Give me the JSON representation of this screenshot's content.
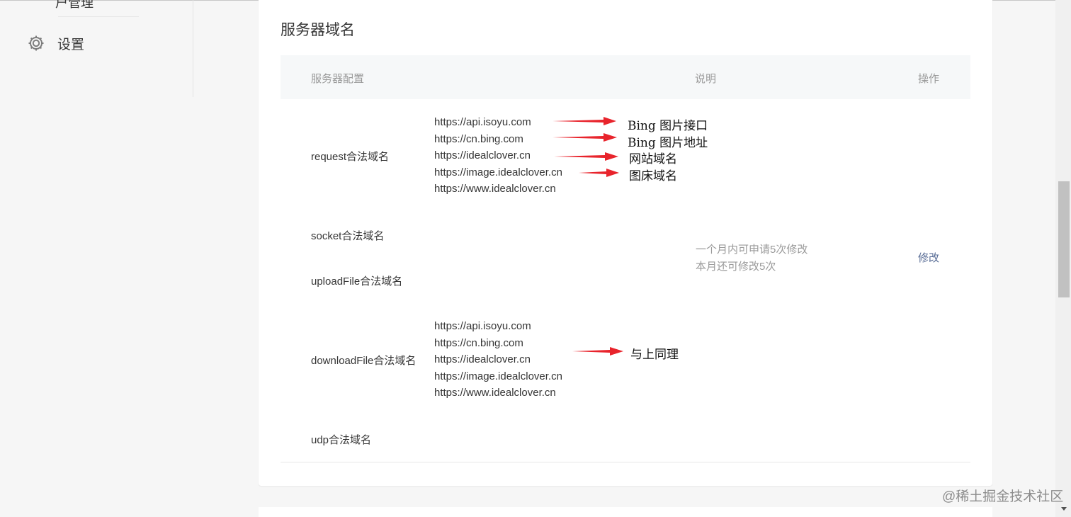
{
  "sidebar": {
    "cut_item_label": "户管理",
    "settings_label": "设置",
    "settings_icon": "gear-icon"
  },
  "card": {
    "title": "服务器域名",
    "headers": {
      "config": "服务器配置",
      "description": "说明",
      "operation": "操作"
    },
    "rows": {
      "request": {
        "label": "request合法域名",
        "domains": [
          "https://api.isoyu.com",
          "https://cn.bing.com",
          "https://idealclover.cn",
          "https://image.idealclover.cn",
          "https://www.idealclover.cn"
        ]
      },
      "socket": {
        "label": "socket合法域名"
      },
      "uploadFile": {
        "label": "uploadFile合法域名"
      },
      "downloadFile": {
        "label": "downloadFile合法域名",
        "domains": [
          "https://api.isoyu.com",
          "https://cn.bing.com",
          "https://idealclover.cn",
          "https://image.idealclover.cn",
          "https://www.idealclover.cn"
        ]
      },
      "udp": {
        "label": "udp合法域名"
      }
    },
    "description_lines": [
      "一个月内可申请5次修改",
      "本月还可修改5次"
    ],
    "modify_link": "修改"
  },
  "annotations": {
    "arrow_color": "#e8242c",
    "request": [
      "Bing 图片接口",
      "Bing 图片地址",
      "网站域名",
      "图床域名"
    ],
    "download": "与上同理"
  },
  "colors": {
    "link": "#576b95",
    "muted": "#9a9a9a",
    "header_bg": "#f6f8f9"
  },
  "watermark": "@稀土掘金技术社区"
}
